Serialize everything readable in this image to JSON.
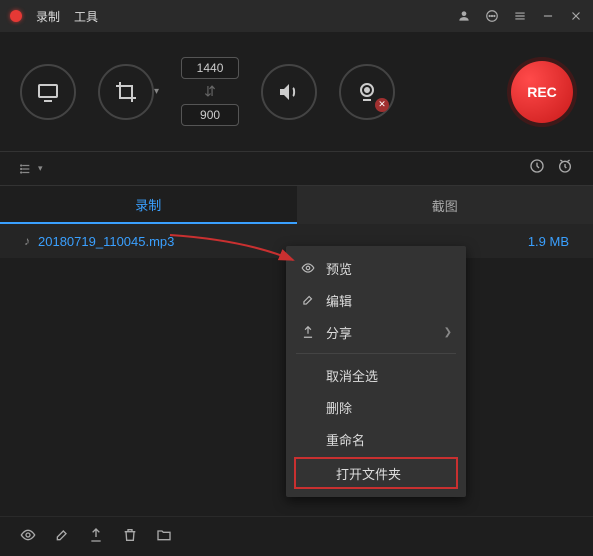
{
  "titlebar": {
    "menu": [
      "录制",
      "工具"
    ]
  },
  "toolbar": {
    "width": "1440",
    "height": "900",
    "rec_label": "REC"
  },
  "tabs": {
    "record": "录制",
    "screenshot": "截图"
  },
  "file": {
    "name": "20180719_110045.mp3",
    "size": "1.9 MB"
  },
  "context_menu": {
    "preview": "预览",
    "edit": "编辑",
    "share": "分享",
    "deselect_all": "取消全选",
    "delete": "删除",
    "rename": "重命名",
    "open_folder": "打开文件夹"
  }
}
